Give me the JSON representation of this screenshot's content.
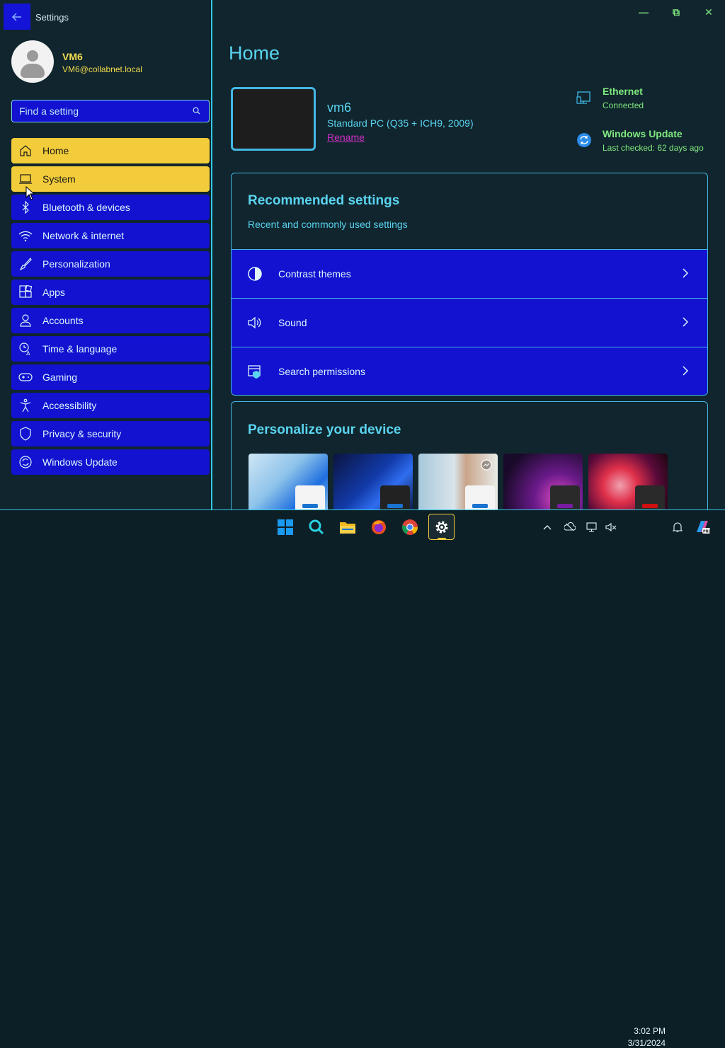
{
  "window": {
    "app_title": "Settings",
    "minimize": "—",
    "restore": "⧉",
    "close": "✕"
  },
  "user": {
    "name": "VM6",
    "email": "VM6@collabnet.local"
  },
  "search": {
    "placeholder": "Find a setting"
  },
  "nav": [
    {
      "label": "Home",
      "icon": "home-icon",
      "active": true
    },
    {
      "label": "System",
      "icon": "laptop-icon",
      "hover": true
    },
    {
      "label": "Bluetooth & devices",
      "icon": "bluetooth-icon"
    },
    {
      "label": "Network & internet",
      "icon": "wifi-icon"
    },
    {
      "label": "Personalization",
      "icon": "brush-icon"
    },
    {
      "label": "Apps",
      "icon": "apps-icon"
    },
    {
      "label": "Accounts",
      "icon": "person-icon"
    },
    {
      "label": "Time & language",
      "icon": "globe-clock-icon"
    },
    {
      "label": "Gaming",
      "icon": "gamepad-icon"
    },
    {
      "label": "Accessibility",
      "icon": "accessibility-icon"
    },
    {
      "label": "Privacy & security",
      "icon": "shield-icon"
    },
    {
      "label": "Windows Update",
      "icon": "sync-icon"
    }
  ],
  "main": {
    "title": "Home",
    "pc": {
      "name": "vm6",
      "model": "Standard PC (Q35 + ICH9, 2009)",
      "rename": "Rename"
    },
    "status": {
      "ethernet_title": "Ethernet",
      "ethernet_sub": "Connected",
      "update_title": "Windows Update",
      "update_sub": "Last checked: 62 days ago"
    },
    "recommended": {
      "title": "Recommended settings",
      "subtitle": "Recent and commonly used settings",
      "items": [
        {
          "label": "Contrast themes",
          "icon": "contrast-icon"
        },
        {
          "label": "Sound",
          "icon": "speaker-icon"
        },
        {
          "label": "Search permissions",
          "icon": "search-permissions-icon"
        }
      ]
    },
    "personalize": {
      "title": "Personalize your device"
    }
  },
  "taskbar": {
    "time": "3:02 PM",
    "date": "3/31/2024",
    "apps": [
      "windows-start-icon",
      "search-icon",
      "file-explorer-icon",
      "firefox-icon",
      "chrome-icon",
      "settings-icon"
    ]
  },
  "colors": {
    "accent_yellow": "#f2cc3a",
    "nav_blue": "#1212d0",
    "cyan": "#5ad4f0",
    "green": "#7fe87f",
    "background": "#10252d"
  }
}
